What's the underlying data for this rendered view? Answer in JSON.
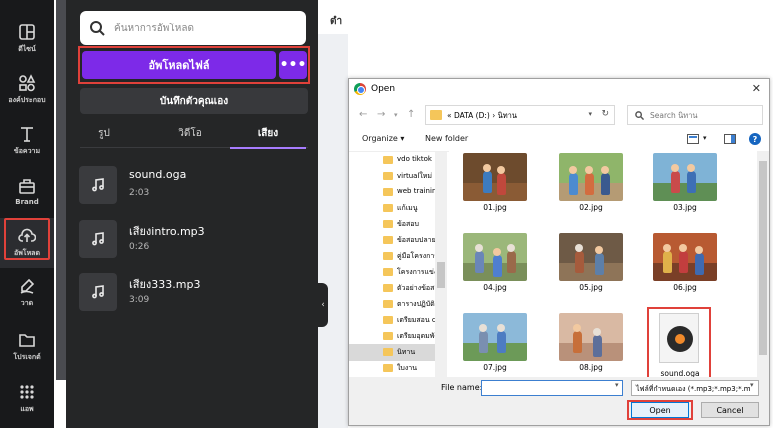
{
  "rail": {
    "items": [
      {
        "label": "ดีไซน์",
        "icon": "layout-icon"
      },
      {
        "label": "องค์ประกอบ",
        "icon": "shapes-icon"
      },
      {
        "label": "ข้อความ",
        "icon": "text-icon"
      },
      {
        "label": "Brand",
        "icon": "brand-icon"
      },
      {
        "label": "อัพโหลด",
        "icon": "cloud-upload-icon"
      },
      {
        "label": "วาด",
        "icon": "pen-icon"
      },
      {
        "label": "โปรเจกต์",
        "icon": "folder-icon"
      },
      {
        "label": "แอพ",
        "icon": "apps-grid-icon"
      }
    ]
  },
  "panel": {
    "search_placeholder": "ค้นหาการอัพโหลด",
    "upload_label": "อัพโหลดไฟล์",
    "more_label": "•••",
    "record_label": "บันทึกตัวคุณเอง",
    "tabs": [
      {
        "label": "รูป"
      },
      {
        "label": "วิดีโอ"
      },
      {
        "label": "เสียง"
      }
    ],
    "audio": [
      {
        "name": "sound.oga",
        "duration": "2:03"
      },
      {
        "name": "เสียงintro.mp3",
        "duration": "0:26"
      },
      {
        "name": "เสียง333.mp3",
        "duration": "3:09"
      }
    ],
    "collapse_glyph": "‹"
  },
  "editor": {
    "top_text": "ตำ"
  },
  "dialog": {
    "title": "Open",
    "close_glyph": "✕",
    "address": "«  DATA (D:)  ›  นิทาน",
    "search_placeholder": "Search นิทาน",
    "organize_label": "Organize ▾",
    "new_folder_label": "New folder",
    "tree": [
      {
        "label": "vdo tiktok"
      },
      {
        "label": "virtualใหม่"
      },
      {
        "label": "web training"
      },
      {
        "label": "แก้เมนู"
      },
      {
        "label": "ข้อสอบ"
      },
      {
        "label": "ข้อสอบปลายภาค"
      },
      {
        "label": "คู่มือโครงการพพ"
      },
      {
        "label": "โครงการแข่งขัน"
      },
      {
        "label": "ตัวอย่างข้อสอบ"
      },
      {
        "label": "ตารางปฏิบัติงาน"
      },
      {
        "label": "เตรียมสอน canva"
      },
      {
        "label": "เตรียมอุดมพัฒน"
      },
      {
        "label": "นิทาน",
        "selected": true
      },
      {
        "label": "ใบงาน"
      }
    ],
    "files": [
      {
        "name": "01.jpg"
      },
      {
        "name": "02.jpg"
      },
      {
        "name": "03.jpg"
      },
      {
        "name": "04.jpg"
      },
      {
        "name": "05.jpg"
      },
      {
        "name": "06.jpg"
      },
      {
        "name": "07.jpg"
      },
      {
        "name": "08.jpg"
      },
      {
        "name": "sound.oga"
      }
    ],
    "filename_label": "File name:",
    "filename_value": "",
    "filetype_value": "ไฟล์ที่กำหนดเอง (*.mp3;*.mp3;*.m",
    "open_label": "Open",
    "cancel_label": "Cancel",
    "help_glyph": "?"
  }
}
